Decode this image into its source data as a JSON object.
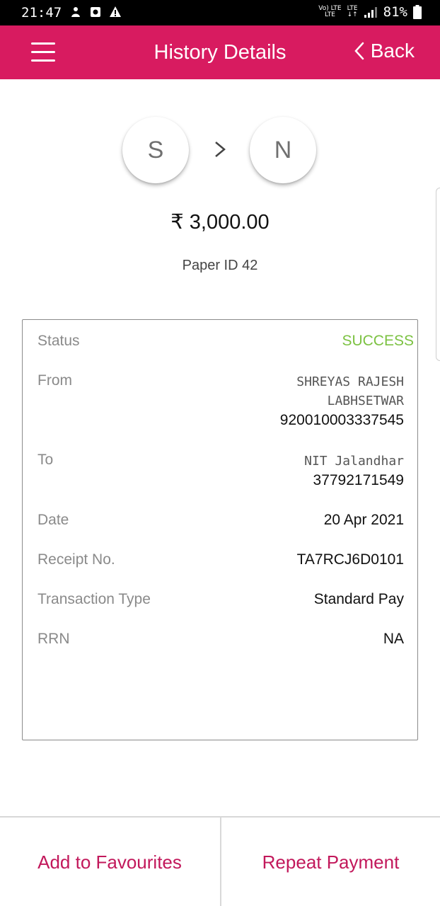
{
  "status_bar": {
    "time": "21:47",
    "network_top": "Vo) LTE",
    "network_bottom": "LTE",
    "lte_label": "LTE",
    "battery": "81%"
  },
  "app_bar": {
    "title": "History Details",
    "back_label": "Back",
    "accent_color": "#d81b60"
  },
  "transfer": {
    "from_initial": "S",
    "to_initial": "N",
    "amount": "₹ 3,000.00",
    "reference": "Paper ID 42"
  },
  "details": {
    "status_label": "Status",
    "status_value": "SUCCESS",
    "status_color": "#7cc242",
    "from_label": "From",
    "from_name_line1": "SHREYAS RAJESH",
    "from_name_line2": "LABHSETWAR",
    "from_account": "920010003337545",
    "to_label": "To",
    "to_name": "NIT Jalandhar",
    "to_account": "37792171549",
    "date_label": "Date",
    "date_value": "20 Apr 2021",
    "receipt_label": "Receipt No.",
    "receipt_value": "TA7RCJ6D0101",
    "type_label": "Transaction Type",
    "type_value": "Standard Pay",
    "rrn_label": "RRN",
    "rrn_value": "NA"
  },
  "actions": {
    "add_favourites": "Add to Favourites",
    "repeat_payment": "Repeat Payment"
  }
}
